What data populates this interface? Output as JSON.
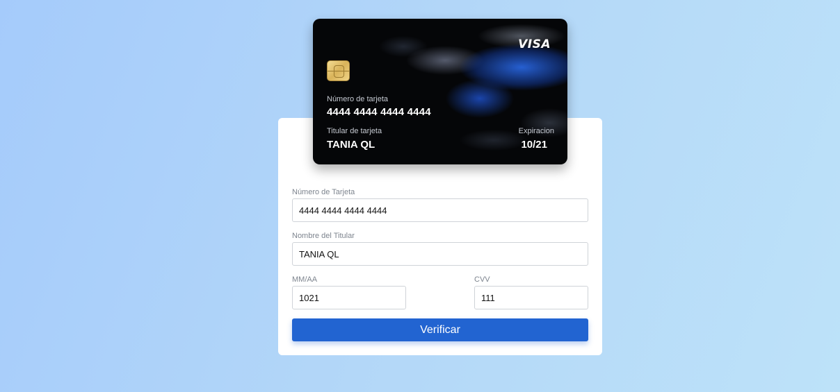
{
  "card": {
    "brand": "VISA",
    "number_label": "Número de tarjeta",
    "number": "4444 4444 4444 4444",
    "holder_label": "Titular de tarjeta",
    "holder": "TANIA QL",
    "expiry_label": "Expiracion",
    "expiry": "10/21"
  },
  "form": {
    "card_number": {
      "label": "Número de Tarjeta",
      "value": "4444 4444 4444 4444"
    },
    "holder_name": {
      "label": "Nombre del Titular",
      "value": "TANIA QL"
    },
    "expiry": {
      "label": "MM/AA",
      "value": "1021"
    },
    "cvv": {
      "label": "CVV",
      "value": "111"
    },
    "submit_label": "Verificar"
  },
  "colors": {
    "background_start": "#a5cbfb",
    "background_end": "#bde2f9",
    "button": "#2264d1",
    "card_background": "#050608"
  }
}
